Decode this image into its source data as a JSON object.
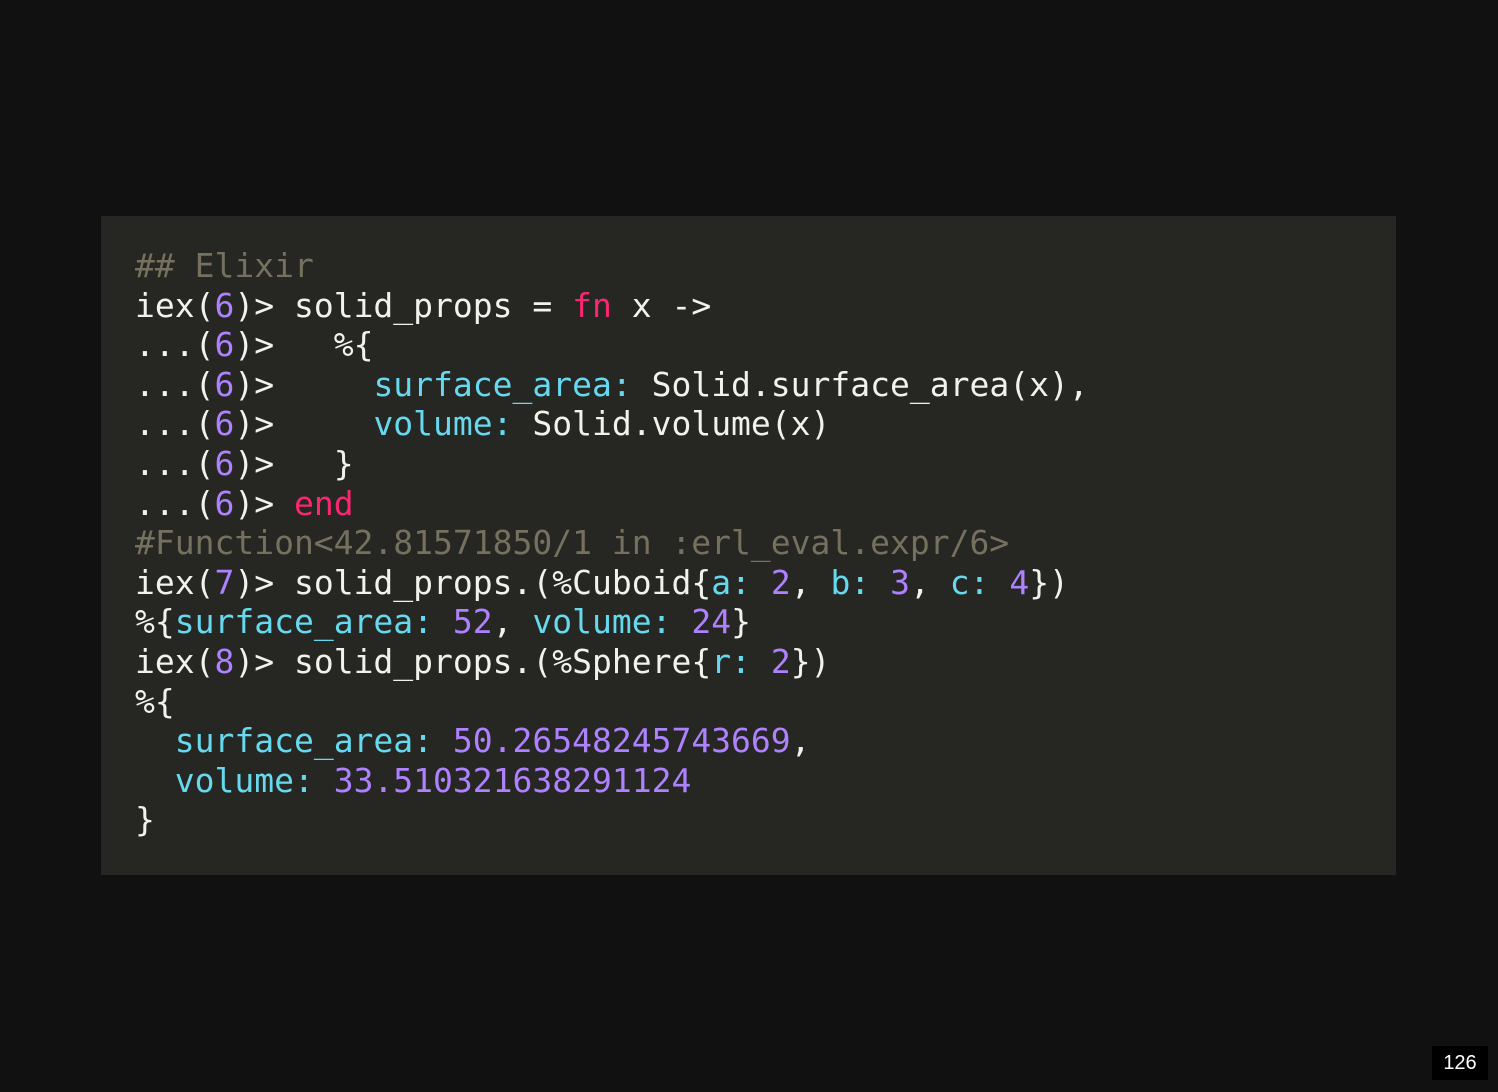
{
  "colors": {
    "background": "#111111",
    "panel": "#262623",
    "plain": "#f2f2ec",
    "comment": "#75715e",
    "number": "#ae81ff",
    "keyword": "#f92672",
    "atom": "#66d9ef"
  },
  "code": {
    "lines": [
      [
        {
          "t": "## Elixir",
          "c": "comment"
        }
      ],
      [
        {
          "t": "iex(",
          "c": "plain"
        },
        {
          "t": "6",
          "c": "num"
        },
        {
          "t": ")> solid_props = ",
          "c": "plain"
        },
        {
          "t": "fn",
          "c": "kw"
        },
        {
          "t": " x ->",
          "c": "plain"
        }
      ],
      [
        {
          "t": "...(",
          "c": "plain"
        },
        {
          "t": "6",
          "c": "num"
        },
        {
          "t": ")>   %{",
          "c": "plain"
        }
      ],
      [
        {
          "t": "...(",
          "c": "plain"
        },
        {
          "t": "6",
          "c": "num"
        },
        {
          "t": ")>     ",
          "c": "plain"
        },
        {
          "t": "surface_area:",
          "c": "atom"
        },
        {
          "t": " Solid.surface_area(x),",
          "c": "plain"
        }
      ],
      [
        {
          "t": "...(",
          "c": "plain"
        },
        {
          "t": "6",
          "c": "num"
        },
        {
          "t": ")>     ",
          "c": "plain"
        },
        {
          "t": "volume:",
          "c": "atom"
        },
        {
          "t": " Solid.volume(x)",
          "c": "plain"
        }
      ],
      [
        {
          "t": "...(",
          "c": "plain"
        },
        {
          "t": "6",
          "c": "num"
        },
        {
          "t": ")>   }",
          "c": "plain"
        }
      ],
      [
        {
          "t": "...(",
          "c": "plain"
        },
        {
          "t": "6",
          "c": "num"
        },
        {
          "t": ")> ",
          "c": "plain"
        },
        {
          "t": "end",
          "c": "kw"
        }
      ],
      [
        {
          "t": "#Function<42.81571850/1 in :erl_eval.expr/6>",
          "c": "comment"
        }
      ],
      [
        {
          "t": "iex(",
          "c": "plain"
        },
        {
          "t": "7",
          "c": "num"
        },
        {
          "t": ")> solid_props.(%Cuboid{",
          "c": "plain"
        },
        {
          "t": "a:",
          "c": "atom"
        },
        {
          "t": " ",
          "c": "plain"
        },
        {
          "t": "2",
          "c": "num"
        },
        {
          "t": ", ",
          "c": "plain"
        },
        {
          "t": "b:",
          "c": "atom"
        },
        {
          "t": " ",
          "c": "plain"
        },
        {
          "t": "3",
          "c": "num"
        },
        {
          "t": ", ",
          "c": "plain"
        },
        {
          "t": "c:",
          "c": "atom"
        },
        {
          "t": " ",
          "c": "plain"
        },
        {
          "t": "4",
          "c": "num"
        },
        {
          "t": "})",
          "c": "plain"
        }
      ],
      [
        {
          "t": "%{",
          "c": "plain"
        },
        {
          "t": "surface_area:",
          "c": "atom"
        },
        {
          "t": " ",
          "c": "plain"
        },
        {
          "t": "52",
          "c": "num"
        },
        {
          "t": ", ",
          "c": "plain"
        },
        {
          "t": "volume:",
          "c": "atom"
        },
        {
          "t": " ",
          "c": "plain"
        },
        {
          "t": "24",
          "c": "num"
        },
        {
          "t": "}",
          "c": "plain"
        }
      ],
      [
        {
          "t": "iex(",
          "c": "plain"
        },
        {
          "t": "8",
          "c": "num"
        },
        {
          "t": ")> solid_props.(%Sphere{",
          "c": "plain"
        },
        {
          "t": "r:",
          "c": "atom"
        },
        {
          "t": " ",
          "c": "plain"
        },
        {
          "t": "2",
          "c": "num"
        },
        {
          "t": "})",
          "c": "plain"
        }
      ],
      [
        {
          "t": "%{",
          "c": "plain"
        }
      ],
      [
        {
          "t": "  ",
          "c": "plain"
        },
        {
          "t": "surface_area:",
          "c": "atom"
        },
        {
          "t": " ",
          "c": "plain"
        },
        {
          "t": "50.26548245743669",
          "c": "num"
        },
        {
          "t": ",",
          "c": "plain"
        }
      ],
      [
        {
          "t": "  ",
          "c": "plain"
        },
        {
          "t": "volume:",
          "c": "atom"
        },
        {
          "t": " ",
          "c": "plain"
        },
        {
          "t": "33.510321638291124",
          "c": "num"
        }
      ],
      [
        {
          "t": "}",
          "c": "plain"
        }
      ]
    ]
  },
  "footer": {
    "page_number": "126"
  }
}
